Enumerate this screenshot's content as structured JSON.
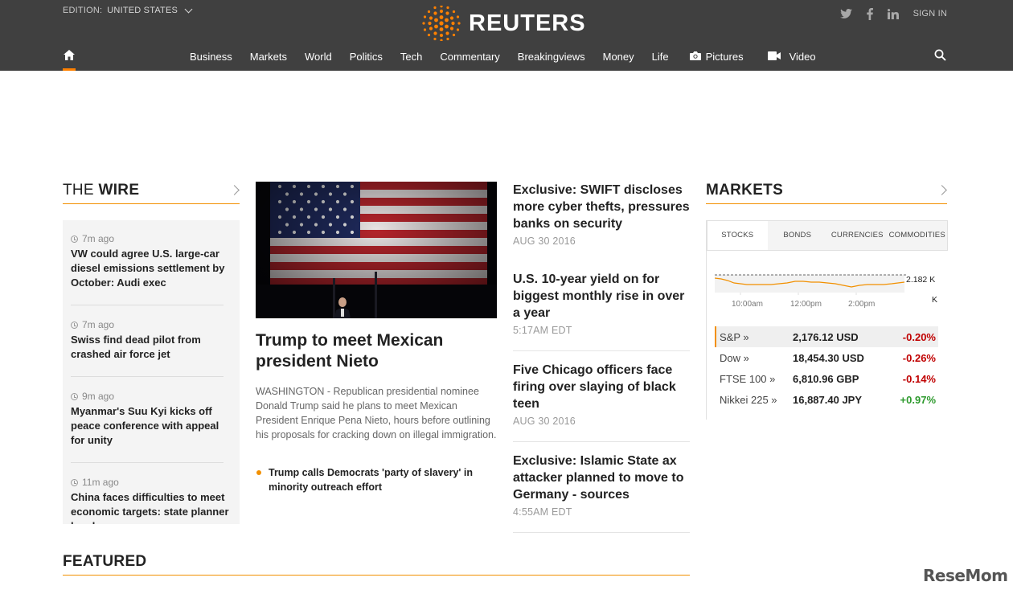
{
  "header": {
    "edition_label": "EDITION:",
    "edition_value": "UNITED STATES",
    "logo_text": "REUTERS",
    "sign_in": "SIGN IN",
    "social_icons": [
      "twitter-icon",
      "facebook-icon",
      "linkedin-icon"
    ]
  },
  "nav": {
    "home_icon": "home-icon",
    "items": [
      {
        "label": "Business"
      },
      {
        "label": "Markets"
      },
      {
        "label": "World"
      },
      {
        "label": "Politics"
      },
      {
        "label": "Tech"
      },
      {
        "label": "Commentary"
      },
      {
        "label": "Breakingviews"
      },
      {
        "label": "Money"
      },
      {
        "label": "Life"
      },
      {
        "label": "Pictures",
        "icon": "camera-icon"
      },
      {
        "label": "Video",
        "icon": "video-icon"
      }
    ],
    "search_icon": "search-icon"
  },
  "wire": {
    "title_light": "THE ",
    "title_bold": "WIRE",
    "items": [
      {
        "time": "7m ago",
        "headline": "VW could agree U.S. large-car diesel emissions settlement by October: Audi exec"
      },
      {
        "time": "7m ago",
        "headline": "Swiss find dead pilot from crashed air force jet"
      },
      {
        "time": "9m ago",
        "headline": "Myanmar's Suu Kyi kicks off peace conference with appeal for unity"
      },
      {
        "time": "11m ago",
        "headline": "China faces difficulties to meet economic targets: state planner head"
      }
    ]
  },
  "lead": {
    "title": "Trump to meet Mexican president Nieto",
    "summary": "WASHINGTON - Republican presidential nominee Donald Trump said he plans to meet Mexican President Enrique Pena Nieto, hours before outlining his proposals for cracking down on illegal immigration.",
    "related": "Trump calls Democrats 'party of slavery' in minority outreach effort"
  },
  "stories": [
    {
      "title": "Exclusive: SWIFT discloses more cyber thefts, pressures banks on security",
      "time": "AUG 30 2016"
    },
    {
      "title": "U.S. 10-year yield on for biggest monthly rise in over a year",
      "time": "5:17AM EDT"
    },
    {
      "title": "Five Chicago officers face firing over slaying of black teen",
      "time": "AUG 30 2016"
    },
    {
      "title": "Exclusive: Islamic State ax attacker planned to move to Germany - sources",
      "time": "4:55AM EDT"
    }
  ],
  "markets": {
    "title": "MARKETS",
    "tabs": [
      "STOCKS",
      "BONDS",
      "CURRENCIES",
      "COMMODITIES"
    ],
    "active_tab": 0,
    "chart": {
      "y_label": "2.182 K",
      "y_unit": "K",
      "x_labels": [
        "10:00am",
        "12:00pm",
        "2:00pm"
      ],
      "line_color": "#f29000"
    },
    "rows": [
      {
        "name": "S&P »",
        "value": "2,176.12 USD",
        "change": "-0.20%",
        "dir": "neg"
      },
      {
        "name": "Dow »",
        "value": "18,454.30 USD",
        "change": "-0.26%",
        "dir": "neg"
      },
      {
        "name": "FTSE 100 »",
        "value": "6,810.96 GBP",
        "change": "-0.14%",
        "dir": "neg"
      },
      {
        "name": "Nikkei 225 »",
        "value": "16,887.40 JPY",
        "change": "+0.97%",
        "dir": "pos"
      }
    ]
  },
  "featured": {
    "title": "FEATURED"
  },
  "watermark": "ReseMom",
  "colors": {
    "accent": "#f29000",
    "header_bg": "#404040",
    "negative": "#c00000",
    "positive": "#2e9a2e"
  }
}
